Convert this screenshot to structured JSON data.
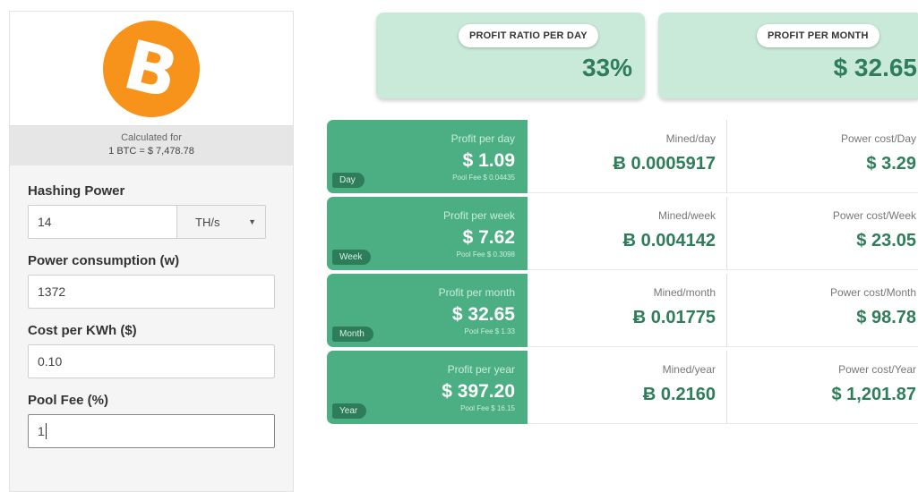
{
  "sidebar": {
    "logo_symbol": "B",
    "calculated_for": "Calculated for",
    "rate": "1 BTC = $ 7,478.78",
    "hashing_power": {
      "label": "Hashing Power",
      "value": "14",
      "unit": "TH/s"
    },
    "power_consumption": {
      "label": "Power consumption (w)",
      "value": "1372"
    },
    "cost_per_kwh": {
      "label": "Cost per KWh ($)",
      "value": "0.10"
    },
    "pool_fee": {
      "label": "Pool Fee (%)",
      "value": "1"
    }
  },
  "summary": {
    "ratio": {
      "label": "PROFIT RATIO PER DAY",
      "value": "33%"
    },
    "month": {
      "label": "PROFIT PER MONTH",
      "value": "$ 32.65"
    }
  },
  "results": [
    {
      "tag": "Day",
      "profit_label": "Profit per day",
      "profit": "$ 1.09",
      "pool_fee": "Pool Fee $ 0.04435",
      "mined_label": "Mined/day",
      "mined": "Ƀ 0.0005917",
      "power_label": "Power cost/Day",
      "power": "$ 3.29"
    },
    {
      "tag": "Week",
      "profit_label": "Profit per week",
      "profit": "$ 7.62",
      "pool_fee": "Pool Fee $ 0.3098",
      "mined_label": "Mined/week",
      "mined": "Ƀ 0.004142",
      "power_label": "Power cost/Week",
      "power": "$ 23.05"
    },
    {
      "tag": "Month",
      "profit_label": "Profit per month",
      "profit": "$ 32.65",
      "pool_fee": "Pool Fee $ 1.33",
      "mined_label": "Mined/month",
      "mined": "Ƀ 0.01775",
      "power_label": "Power cost/Month",
      "power": "$ 98.78"
    },
    {
      "tag": "Year",
      "profit_label": "Profit per year",
      "profit": "$ 397.20",
      "pool_fee": "Pool Fee $ 16.15",
      "mined_label": "Mined/year",
      "mined": "Ƀ 0.2160",
      "power_label": "Power cost/Year",
      "power": "$ 1,201.87"
    }
  ]
}
